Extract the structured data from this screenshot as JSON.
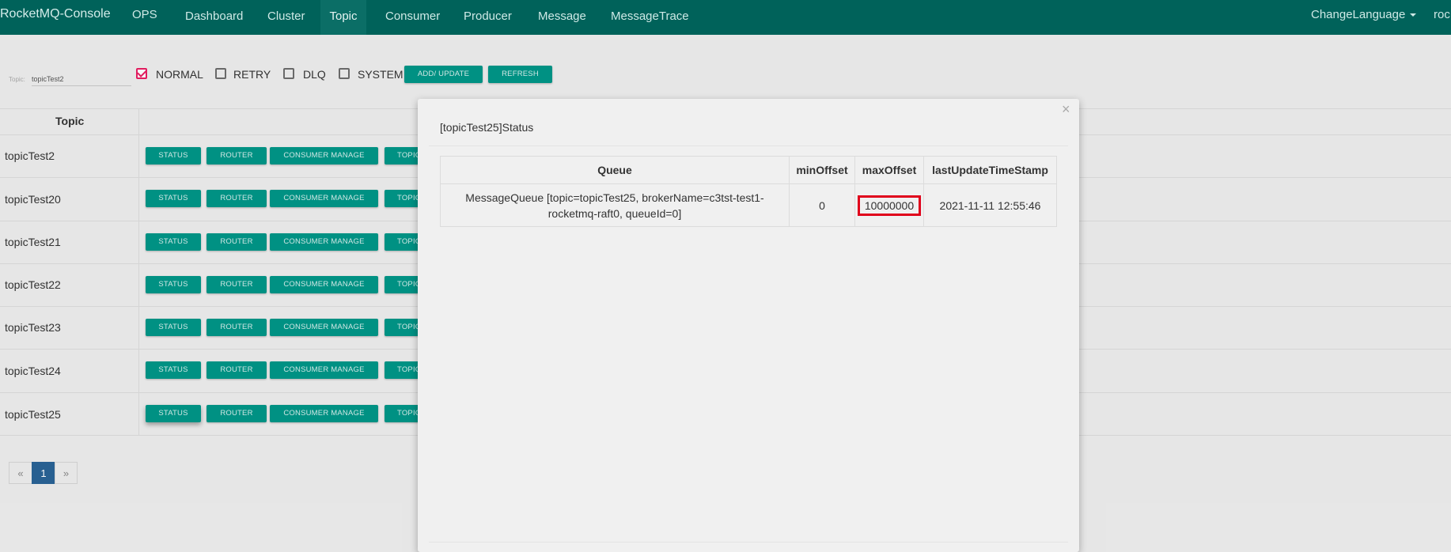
{
  "navbar": {
    "brand": "RocketMQ-Console",
    "items": [
      "OPS",
      "Dashboard",
      "Cluster",
      "Topic",
      "Consumer",
      "Producer",
      "Message",
      "MessageTrace"
    ],
    "active": "Topic",
    "change_language": "ChangeLanguage",
    "user_truncated": "roc"
  },
  "filter": {
    "topic_label": "Topic:",
    "topic_value": "topicTest2",
    "checkboxes": [
      {
        "label": "NORMAL",
        "checked": true
      },
      {
        "label": "RETRY",
        "checked": false
      },
      {
        "label": "DLQ",
        "checked": false
      },
      {
        "label": "SYSTEM",
        "checked": false
      }
    ],
    "add_update_label": "ADD/ UPDATE",
    "refresh_label": "REFRESH"
  },
  "table": {
    "header_topic": "Topic",
    "rows": [
      {
        "topic": "topicTest2"
      },
      {
        "topic": "topicTest20"
      },
      {
        "topic": "topicTest21"
      },
      {
        "topic": "topicTest22"
      },
      {
        "topic": "topicTest23"
      },
      {
        "topic": "topicTest24"
      },
      {
        "topic": "topicTest25"
      }
    ],
    "row_buttons": {
      "status": "STATUS",
      "router": "ROUTER",
      "consumer_manage": "CONSUMER MANAGE",
      "topic_config_truncated": "TOPIC"
    }
  },
  "pagination": {
    "prev": "«",
    "current": "1",
    "next": "»"
  },
  "modal": {
    "title": "[topicTest25]Status",
    "close": "×",
    "columns": [
      "Queue",
      "minOffset",
      "maxOffset",
      "lastUpdateTimeStamp"
    ],
    "rows": [
      {
        "queue_line1": "MessageQueue [topic=topicTest25, brokerName=c3tst-test1-",
        "queue_line2": "rocketmq-raft0, queueId=0]",
        "minOffset": "0",
        "maxOffset": "10000000",
        "lastUpdateTimeStamp": "2021-11-11 12:55:46"
      }
    ],
    "highlight_color": "#e0001b"
  },
  "colors": {
    "navbar": "#00625a",
    "button": "#009688",
    "checkbox_checked": "#e91e63",
    "page_active": "#2a6496"
  }
}
